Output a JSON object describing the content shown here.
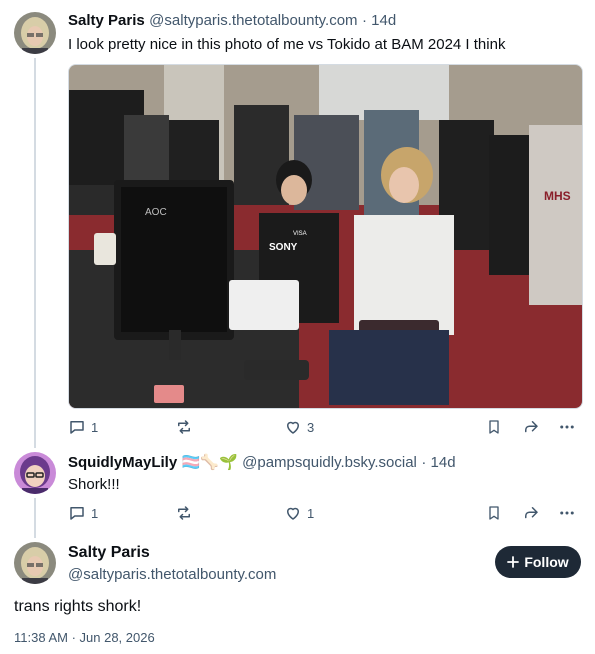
{
  "posts": [
    {
      "author": "Salty Paris",
      "handle": "@saltyparis.thetotalbounty.com",
      "time": "· 14d",
      "text": "I look pretty nice in this photo of me vs Tokido at BAM 2024 I think",
      "reply_count": "1",
      "like_count": "3",
      "image": {
        "monitor_brand": "AOC",
        "jersey_sponsor": "SONY",
        "jersey_sponsor_small": "VISA",
        "shirt_text": "MHS"
      }
    },
    {
      "author": "SquidlyMayLily",
      "name_emojis": "🏳️‍⚧️🦴🌱",
      "handle": "@pampsquidly.bsky.social",
      "time": "· 14d",
      "text": "Shork!!!",
      "reply_count": "1",
      "like_count": "1"
    }
  ],
  "focused_post": {
    "author": "Salty Paris",
    "handle": "@saltyparis.thetotalbounty.com",
    "follow_label": "Follow",
    "follow_icon": "plus-icon",
    "text": "trans rights shork!",
    "timestamp": "11:38 AM · Jun 28, 2026"
  },
  "icons": [
    "reply-icon",
    "repost-icon",
    "like-icon",
    "bookmark-icon",
    "share-icon",
    "more-icon"
  ],
  "colors": {
    "follow_bg": "#1e2936",
    "muted": "#42576c",
    "thread_line": "#d4dbe2"
  }
}
